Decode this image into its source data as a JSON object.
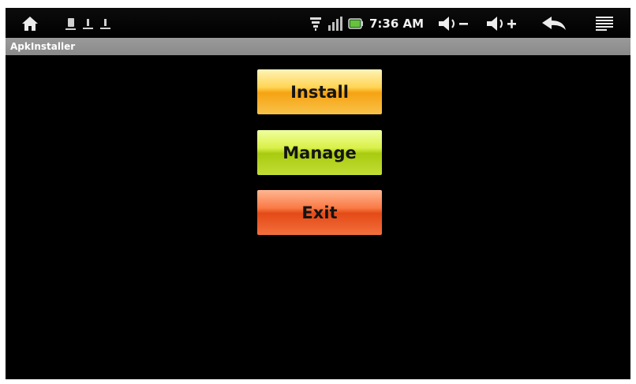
{
  "status_bar": {
    "time": "7:36 AM",
    "icons": {
      "home": "home-icon",
      "notifications": [
        "sd-card-icon",
        "download-icon",
        "download-icon"
      ],
      "wifi": "wifi-icon",
      "signal": "signal-icon",
      "battery": "battery-icon",
      "volume_down": "volume-down-icon",
      "volume_up": "volume-up-icon",
      "back": "back-icon",
      "menu": "menu-icon"
    }
  },
  "app": {
    "title": "ApkInstaller"
  },
  "buttons": {
    "install": "Install",
    "manage": "Manage",
    "exit": "Exit"
  },
  "colors": {
    "install": "#f6a312",
    "manage": "#a8cb10",
    "exit": "#e44a16",
    "title_bar": "#8f8f8f",
    "background": "#000000"
  }
}
